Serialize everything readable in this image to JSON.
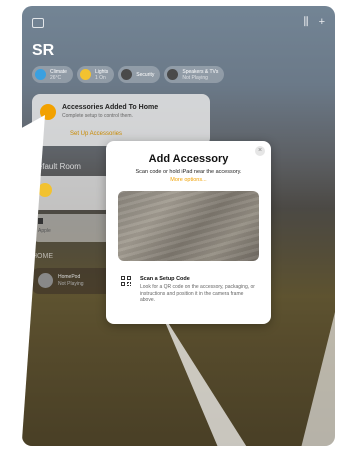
{
  "home": {
    "title": "SR",
    "top_right_icons": [
      "waveform-icon",
      "plus-icon"
    ]
  },
  "chips": [
    {
      "label": "Climate",
      "sub": "26°C",
      "color": "#3aa0e0"
    },
    {
      "label": "Lights",
      "sub": "1 On",
      "color": "#f2c230"
    },
    {
      "label": "Security",
      "sub": "",
      "color": "#4a4a4a"
    },
    {
      "label": "Speakers & TVs",
      "sub": "Not Playing",
      "color": "#4a4a4a"
    }
  ],
  "banner": {
    "title": "Accessories Added To Home",
    "subtitle": "Complete setup to control them.",
    "link": "Set Up Accessories"
  },
  "sections": {
    "default_room": "Default Room",
    "second": "HOME"
  },
  "tiles": {
    "tile2_label": "Apple"
  },
  "homepod": {
    "name": "HomePod",
    "status": "Not Playing"
  },
  "modal": {
    "title": "Add Accessory",
    "subtitle": "Scan code or hold iPad near the accessory.",
    "more_options": "More options...",
    "close": "×",
    "scan_title": "Scan a Setup Code",
    "scan_description": "Look for a QR code on the accessory, packaging, or instructions and position it in the camera frame above."
  }
}
